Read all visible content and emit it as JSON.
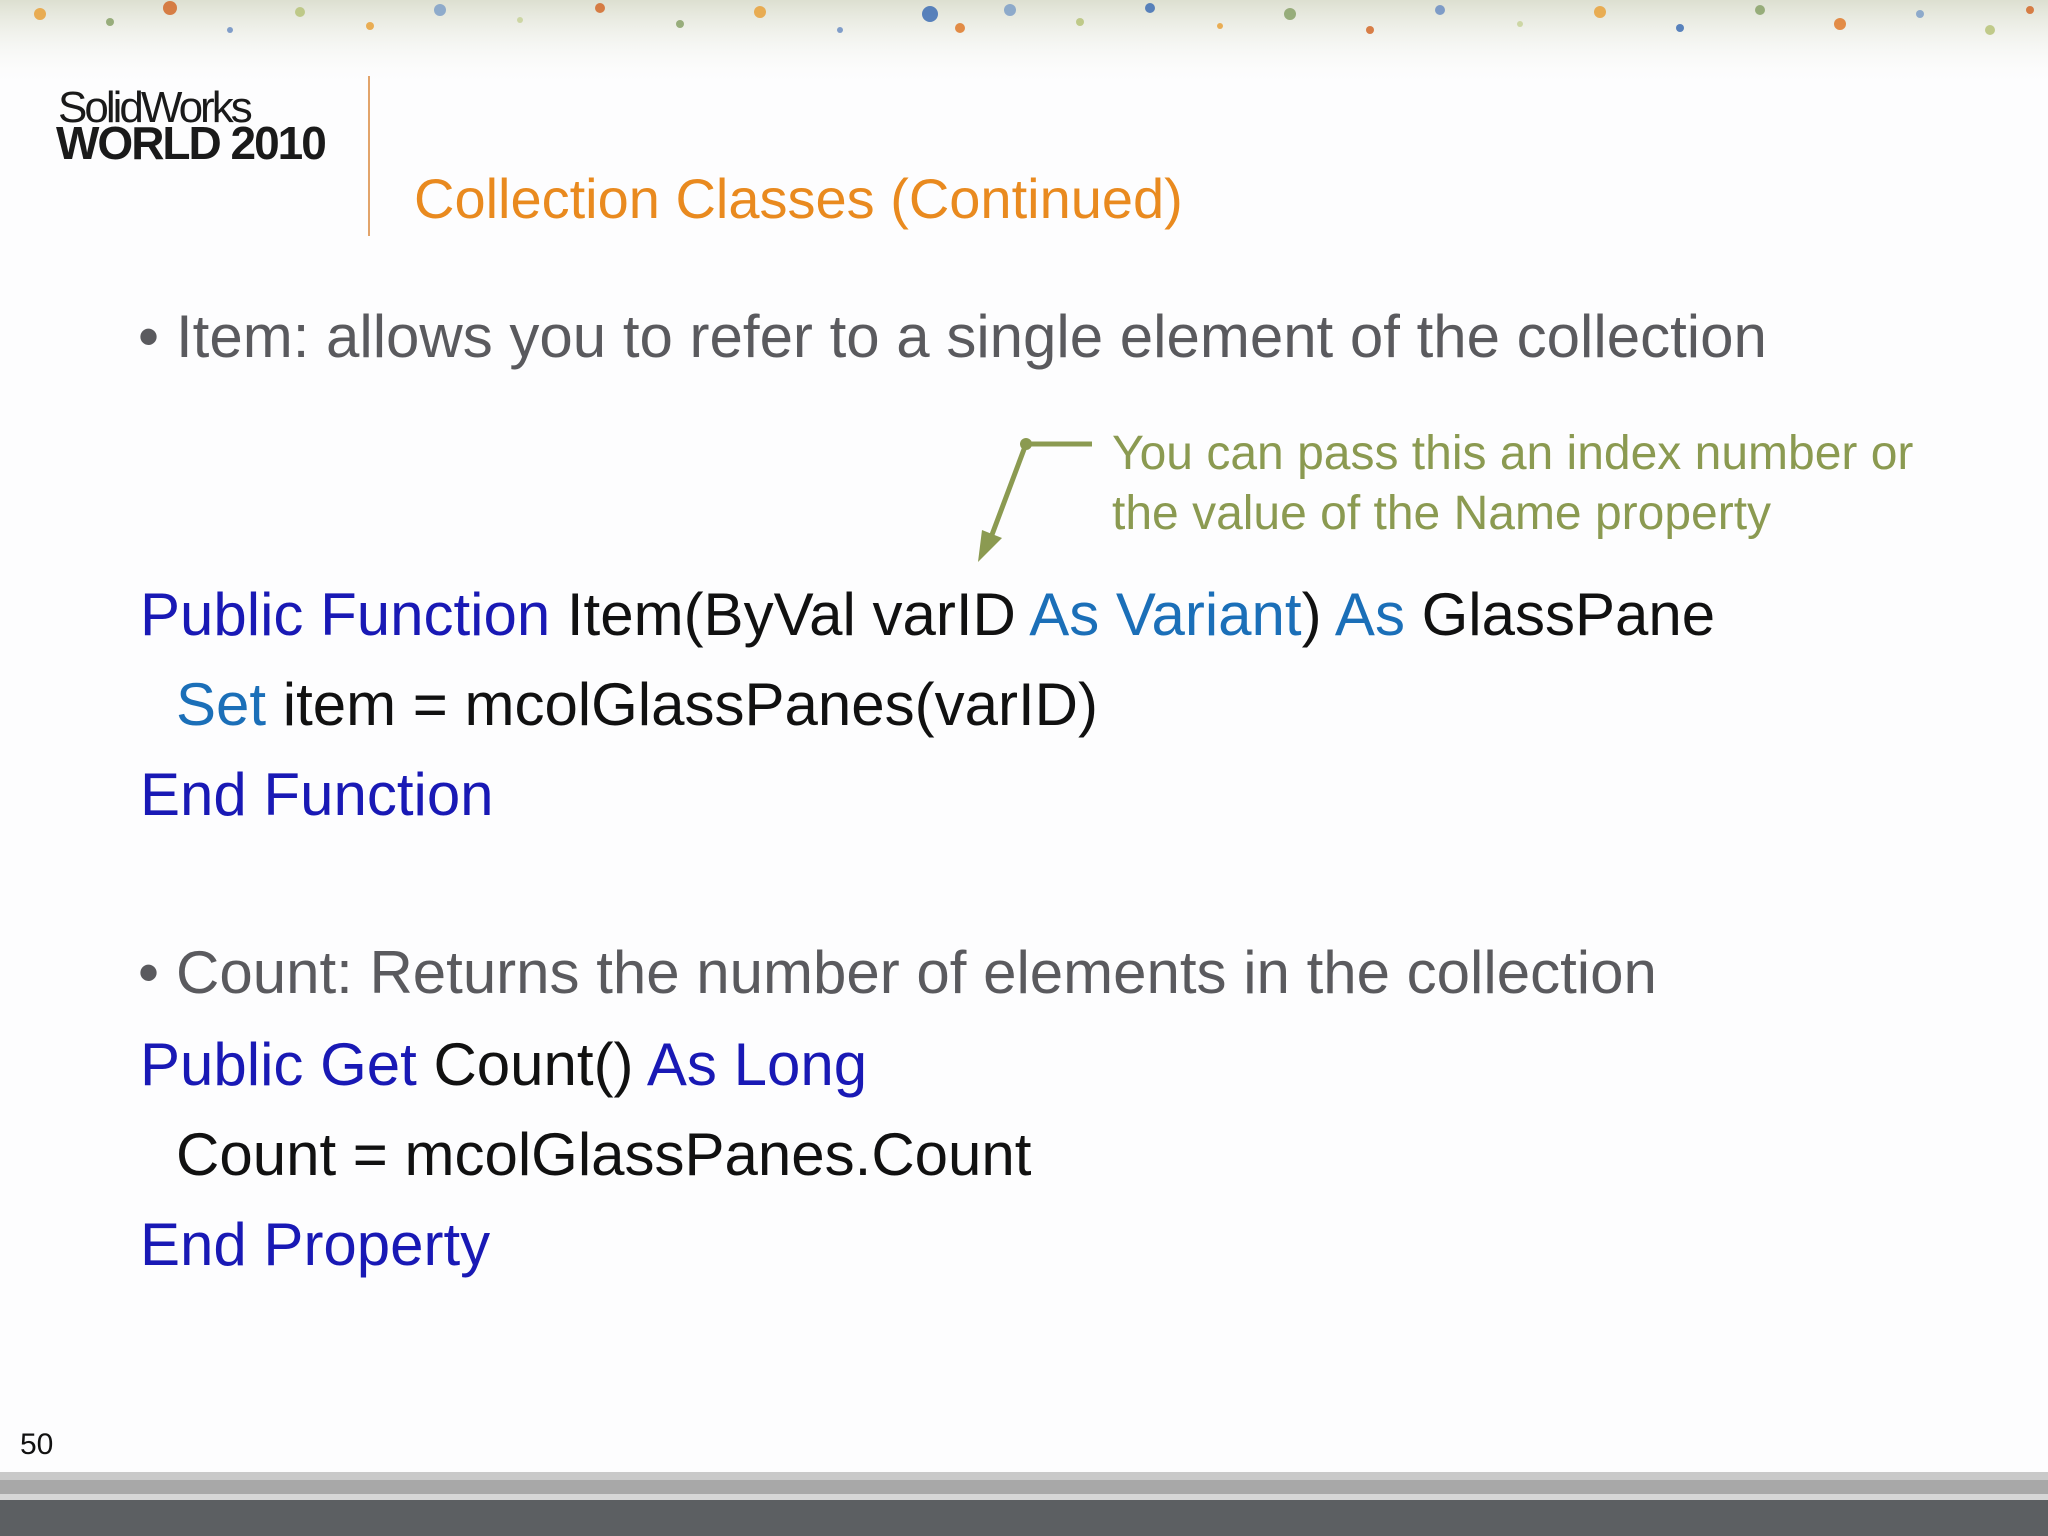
{
  "logo": {
    "line1": "SolidWorks",
    "line2": "WORLD 2010"
  },
  "title": "Collection Classes (Continued)",
  "bullets": {
    "item": "Item: allows you to refer to a single element of the collection",
    "count": "Count: Returns the number of elements in the collection"
  },
  "callout": {
    "line1": "You can pass this an index number or",
    "line2": "the value of the Name property"
  },
  "code": {
    "item_function": {
      "line1": {
        "t1": "Public Function",
        "t2": " Item(ByVal varID ",
        "t3": "As Variant",
        "t4": ") ",
        "t5": "As",
        "t6": " GlassPane"
      },
      "line2": {
        "t1": "Set",
        "t2": " item = mcolGlassPanes(varID)"
      },
      "line3": "End Function"
    },
    "count_property": {
      "line1": {
        "t1": "Public Get",
        "t2": " Count() ",
        "t3": "As Long"
      },
      "line2": "Count = mcolGlassPanes.Count",
      "line3": "End Property"
    }
  },
  "page_number": "50",
  "colors": {
    "title": "#e98a1f",
    "bullet_text": "#5a5a5e",
    "callout": "#8b9a51",
    "keyword": "#1919b5",
    "keyword_light": "#1b6fb8",
    "code_text": "#111111"
  }
}
